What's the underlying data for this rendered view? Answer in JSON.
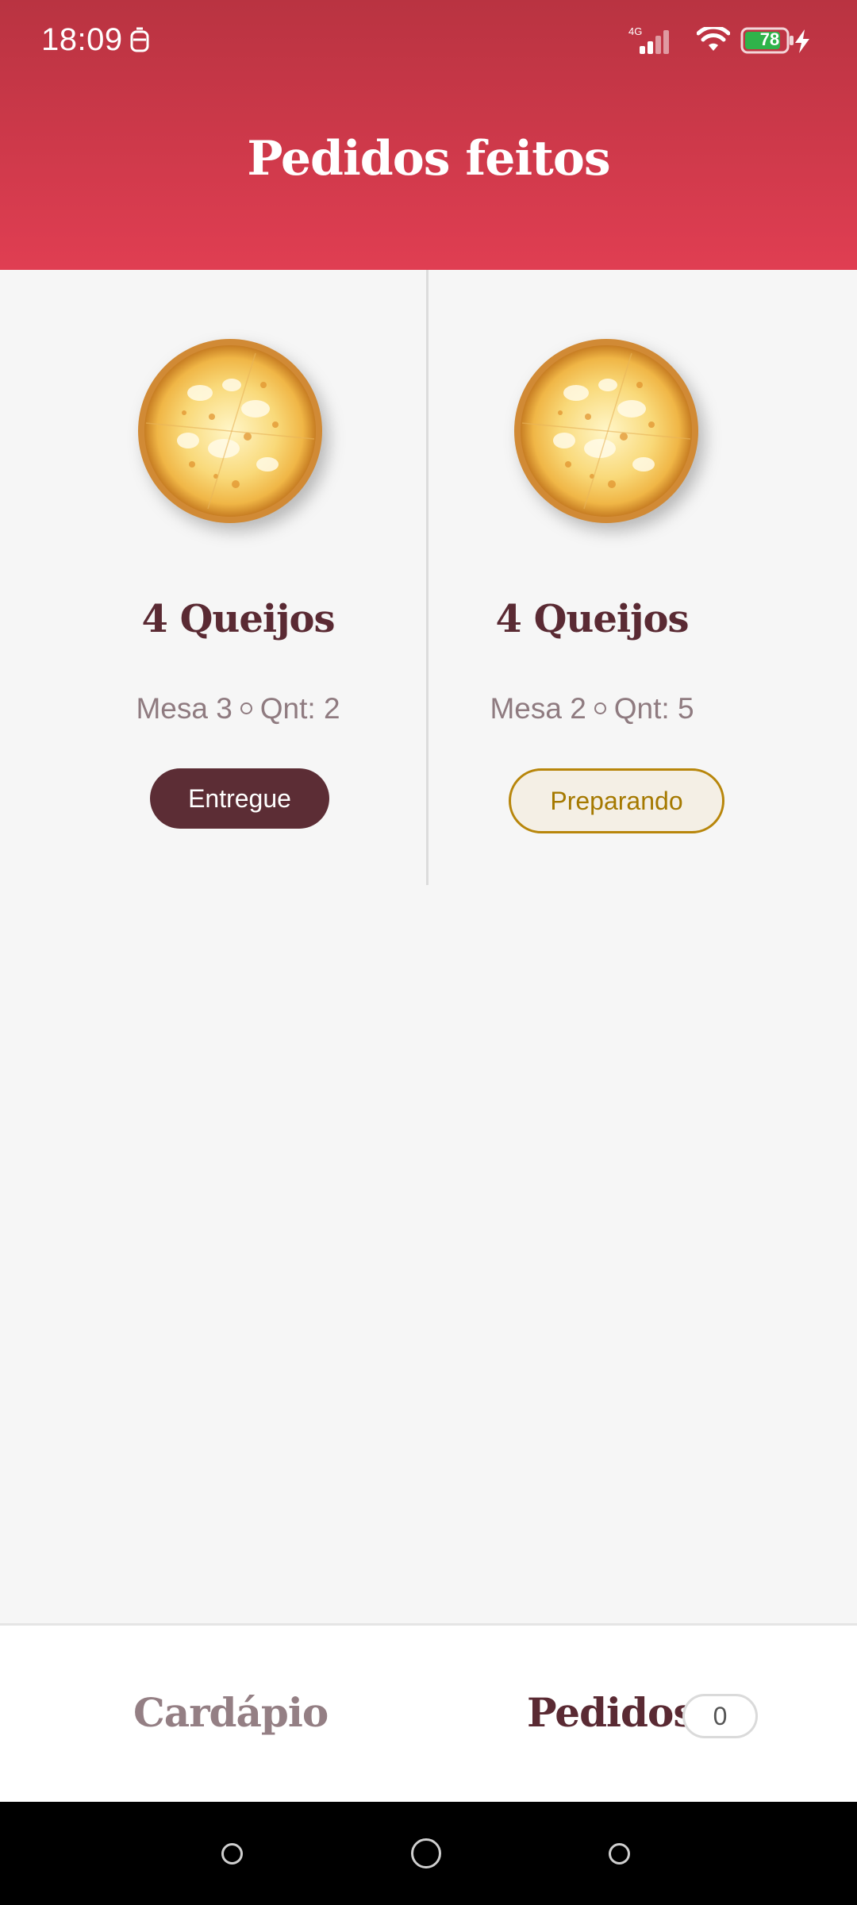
{
  "status_bar": {
    "time": "18:09",
    "network": "4G",
    "battery": "78"
  },
  "header": {
    "title": "Pedidos feitos"
  },
  "orders": [
    {
      "name": "4 Queijos",
      "table": "Mesa 3",
      "quantity": "Qnt: 2",
      "status": "Entregue"
    },
    {
      "name": "4 Queijos",
      "table": "Mesa 2",
      "quantity": "Qnt: 5",
      "status": "Preparando"
    }
  ],
  "bottom_nav": {
    "menu_label": "Cardápio",
    "orders_label": "Pedidos",
    "orders_badge": "0"
  },
  "colors": {
    "header_top": "#b93341",
    "header_bottom": "#e03e52",
    "brand_dark": "#5a2a33",
    "muted": "#8f7b80",
    "preparing": "#b8860b"
  }
}
